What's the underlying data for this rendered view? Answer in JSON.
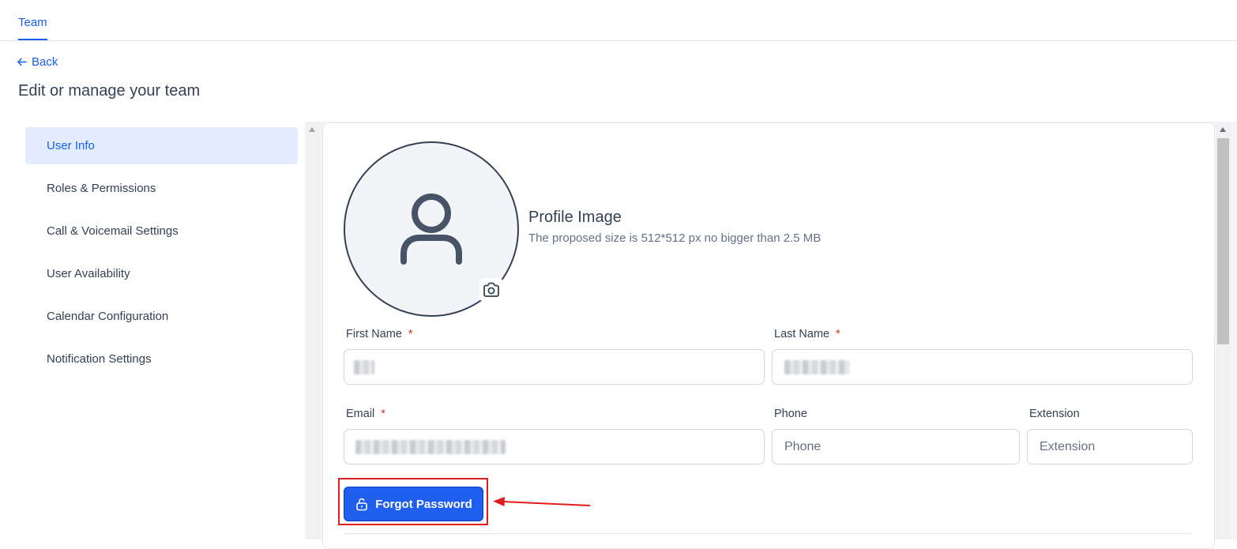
{
  "header": {
    "tab_label": "Team",
    "back_label": "Back",
    "page_title": "Edit or manage your team"
  },
  "sidebar": {
    "items": [
      {
        "label": "User Info",
        "active": true
      },
      {
        "label": "Roles & Permissions",
        "active": false
      },
      {
        "label": "Call & Voicemail Settings",
        "active": false
      },
      {
        "label": "User Availability",
        "active": false
      },
      {
        "label": "Calendar Configuration",
        "active": false
      },
      {
        "label": "Notification Settings",
        "active": false
      }
    ]
  },
  "profile": {
    "title": "Profile Image",
    "hint": "The proposed size is 512*512 px no bigger than 2.5 MB"
  },
  "form": {
    "required_mark": "*",
    "first_name": {
      "label": "First Name"
    },
    "last_name": {
      "label": "Last Name"
    },
    "email": {
      "label": "Email"
    },
    "phone": {
      "label": "Phone",
      "placeholder": "Phone"
    },
    "extension": {
      "label": "Extension",
      "placeholder": "Extension"
    }
  },
  "actions": {
    "forgot_password_label": "Forgot Password"
  },
  "colors": {
    "accent": "#155eef",
    "button": "#1f5eef",
    "highlight": "#e11d1d",
    "active_nav_bg": "#e3edff"
  },
  "icons": {
    "back": "arrow-left-icon",
    "avatar": "user-icon",
    "camera": "camera-icon",
    "forgot": "unlock-icon",
    "annotation": "red-arrow-icon"
  }
}
